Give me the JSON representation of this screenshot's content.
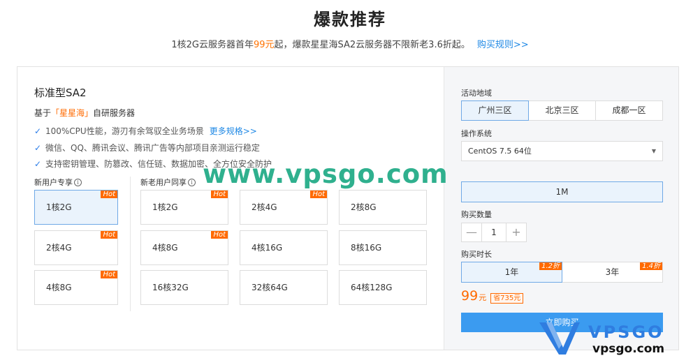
{
  "header": {
    "title": "爆款推荐",
    "subtitle_before": "1核2G云服务器首年",
    "subtitle_price": "99元",
    "subtitle_after": "起，爆款星星海SA2云服务器不限新老3.6折起。",
    "rules_link": "购买规则>>"
  },
  "product": {
    "name": "标准型SA2",
    "desc_before": "基于",
    "desc_brand": "「星星海」",
    "desc_after": "自研服务器",
    "features": [
      "100%CPU性能，游刃有余驾驭全业务场景",
      "微信、QQ、腾讯会议、腾讯广告等内部项目亲测运行稳定",
      "支持密钥管理、防篡改、信任链、数据加密、全方位安全防护"
    ],
    "more_link": "更多规格>>"
  },
  "specs": {
    "new_label": "新用户专享",
    "all_label": "新老用户同享",
    "hot_label": "Hot",
    "new_users": [
      {
        "label": "1核2G",
        "hot": true,
        "active": true
      },
      {
        "label": "2核4G",
        "hot": true
      },
      {
        "label": "4核8G",
        "hot": true
      }
    ],
    "all_users": [
      {
        "label": "1核2G",
        "hot": true
      },
      {
        "label": "2核4G",
        "hot": true
      },
      {
        "label": "2核8G",
        "hot": false
      },
      {
        "label": "4核8G",
        "hot": true
      },
      {
        "label": "4核16G",
        "hot": false
      },
      {
        "label": "8核16G",
        "hot": false
      },
      {
        "label": "16核32G",
        "hot": false
      },
      {
        "label": "32核64G",
        "hot": false
      },
      {
        "label": "64核128G",
        "hot": false
      }
    ]
  },
  "watermark": "www.vpsgo.com",
  "order": {
    "region_label": "活动地域",
    "regions": [
      "广州三区",
      "北京三区",
      "成都一区"
    ],
    "os_label": "操作系统",
    "os_value": "CentOS 7.5 64位",
    "bandwidth": "1M",
    "qty_label": "购买数量",
    "qty_minus": "—",
    "qty_value": "1",
    "qty_plus": "+",
    "duration_label": "购买时长",
    "durations": [
      {
        "label": "1年",
        "discount": "1.2折"
      },
      {
        "label": "3年",
        "discount": "1.4折"
      }
    ],
    "price": "99",
    "price_unit": "元",
    "save": "省735元",
    "buy": "立即购买"
  },
  "logo": {
    "brand": "VPSGO",
    "site": "vpsgo.com"
  },
  "colors": {
    "accent": "#ff6a00",
    "link": "#1e88e5",
    "primary": "#3b9bf0",
    "watermark": "#2fb08e"
  }
}
